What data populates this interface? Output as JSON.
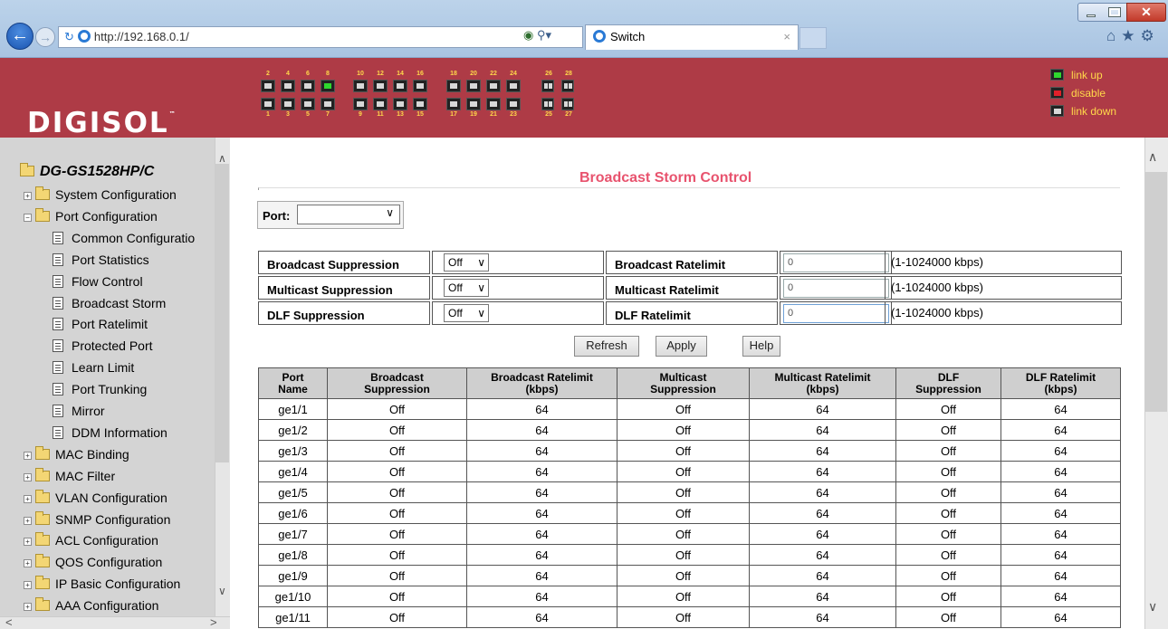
{
  "browser": {
    "url": "http://192.168.0.1/",
    "tab_title": "Switch",
    "tab_close": "×"
  },
  "banner": {
    "logo": "DIGISOL",
    "logo_tm": "™",
    "port_top_numbers": [
      "2",
      "4",
      "6",
      "8",
      "10",
      "12",
      "14",
      "16",
      "18",
      "20",
      "22",
      "24",
      "26",
      "28"
    ],
    "port_bottom_numbers": [
      "1",
      "3",
      "5",
      "7",
      "9",
      "11",
      "13",
      "15",
      "17",
      "19",
      "21",
      "23",
      "25",
      "27"
    ],
    "port_8_status": "link up",
    "legend": [
      "link up",
      "disable",
      "link down"
    ]
  },
  "sidebar": {
    "root": "DG-GS1528HP/C",
    "items": [
      {
        "label": "System Configuration",
        "type": "folder"
      },
      {
        "label": "Port Configuration",
        "type": "folder-open"
      },
      {
        "label": "Common Configuratio",
        "type": "leaf"
      },
      {
        "label": "Port Statistics",
        "type": "leaf"
      },
      {
        "label": "Flow Control",
        "type": "leaf"
      },
      {
        "label": "Broadcast Storm",
        "type": "leaf"
      },
      {
        "label": "Port Ratelimit",
        "type": "leaf"
      },
      {
        "label": "Protected Port",
        "type": "leaf"
      },
      {
        "label": "Learn Limit",
        "type": "leaf"
      },
      {
        "label": "Port Trunking",
        "type": "leaf"
      },
      {
        "label": "Mirror",
        "type": "leaf"
      },
      {
        "label": "DDM Information",
        "type": "leaf"
      },
      {
        "label": "MAC Binding",
        "type": "folder"
      },
      {
        "label": "MAC Filter",
        "type": "folder"
      },
      {
        "label": "VLAN Configuration",
        "type": "folder"
      },
      {
        "label": "SNMP Configuration",
        "type": "folder"
      },
      {
        "label": "ACL Configuration",
        "type": "folder"
      },
      {
        "label": "QOS Configuration",
        "type": "folder"
      },
      {
        "label": "IP Basic Configuration",
        "type": "folder"
      },
      {
        "label": "AAA Configuration",
        "type": "folder"
      }
    ]
  },
  "page": {
    "title": "Broadcast Storm Control",
    "port_label": "Port:",
    "port_value": "",
    "controls": [
      {
        "suppression_label": "Broadcast Suppression",
        "suppression_value": "Off",
        "ratelimit_label": "Broadcast Ratelimit",
        "ratelimit_value": "0",
        "range": "(1-1024000 kbps)"
      },
      {
        "suppression_label": "Multicast Suppression",
        "suppression_value": "Off",
        "ratelimit_label": "Multicast Ratelimit",
        "ratelimit_value": "0",
        "range": "(1-1024000 kbps)"
      },
      {
        "suppression_label": "DLF Suppression",
        "suppression_value": "Off",
        "ratelimit_label": "DLF Ratelimit",
        "ratelimit_value": "0",
        "range": "(1-1024000 kbps)"
      }
    ],
    "buttons": {
      "refresh": "Refresh",
      "apply": "Apply",
      "help": "Help"
    },
    "table": {
      "headers": [
        [
          "Port",
          "Name"
        ],
        [
          "Broadcast",
          "Suppression"
        ],
        [
          "Broadcast Ratelimit",
          "(kbps)"
        ],
        [
          "Multicast",
          "Suppression"
        ],
        [
          "Multicast Ratelimit",
          "(kbps)"
        ],
        [
          "DLF",
          "Suppression"
        ],
        [
          "DLF Ratelimit",
          "(kbps)"
        ]
      ],
      "rows": [
        [
          "ge1/1",
          "Off",
          "64",
          "Off",
          "64",
          "Off",
          "64"
        ],
        [
          "ge1/2",
          "Off",
          "64",
          "Off",
          "64",
          "Off",
          "64"
        ],
        [
          "ge1/3",
          "Off",
          "64",
          "Off",
          "64",
          "Off",
          "64"
        ],
        [
          "ge1/4",
          "Off",
          "64",
          "Off",
          "64",
          "Off",
          "64"
        ],
        [
          "ge1/5",
          "Off",
          "64",
          "Off",
          "64",
          "Off",
          "64"
        ],
        [
          "ge1/6",
          "Off",
          "64",
          "Off",
          "64",
          "Off",
          "64"
        ],
        [
          "ge1/7",
          "Off",
          "64",
          "Off",
          "64",
          "Off",
          "64"
        ],
        [
          "ge1/8",
          "Off",
          "64",
          "Off",
          "64",
          "Off",
          "64"
        ],
        [
          "ge1/9",
          "Off",
          "64",
          "Off",
          "64",
          "Off",
          "64"
        ],
        [
          "ge1/10",
          "Off",
          "64",
          "Off",
          "64",
          "Off",
          "64"
        ],
        [
          "ge1/11",
          "Off",
          "64",
          "Off",
          "64",
          "Off",
          "64"
        ]
      ]
    }
  }
}
